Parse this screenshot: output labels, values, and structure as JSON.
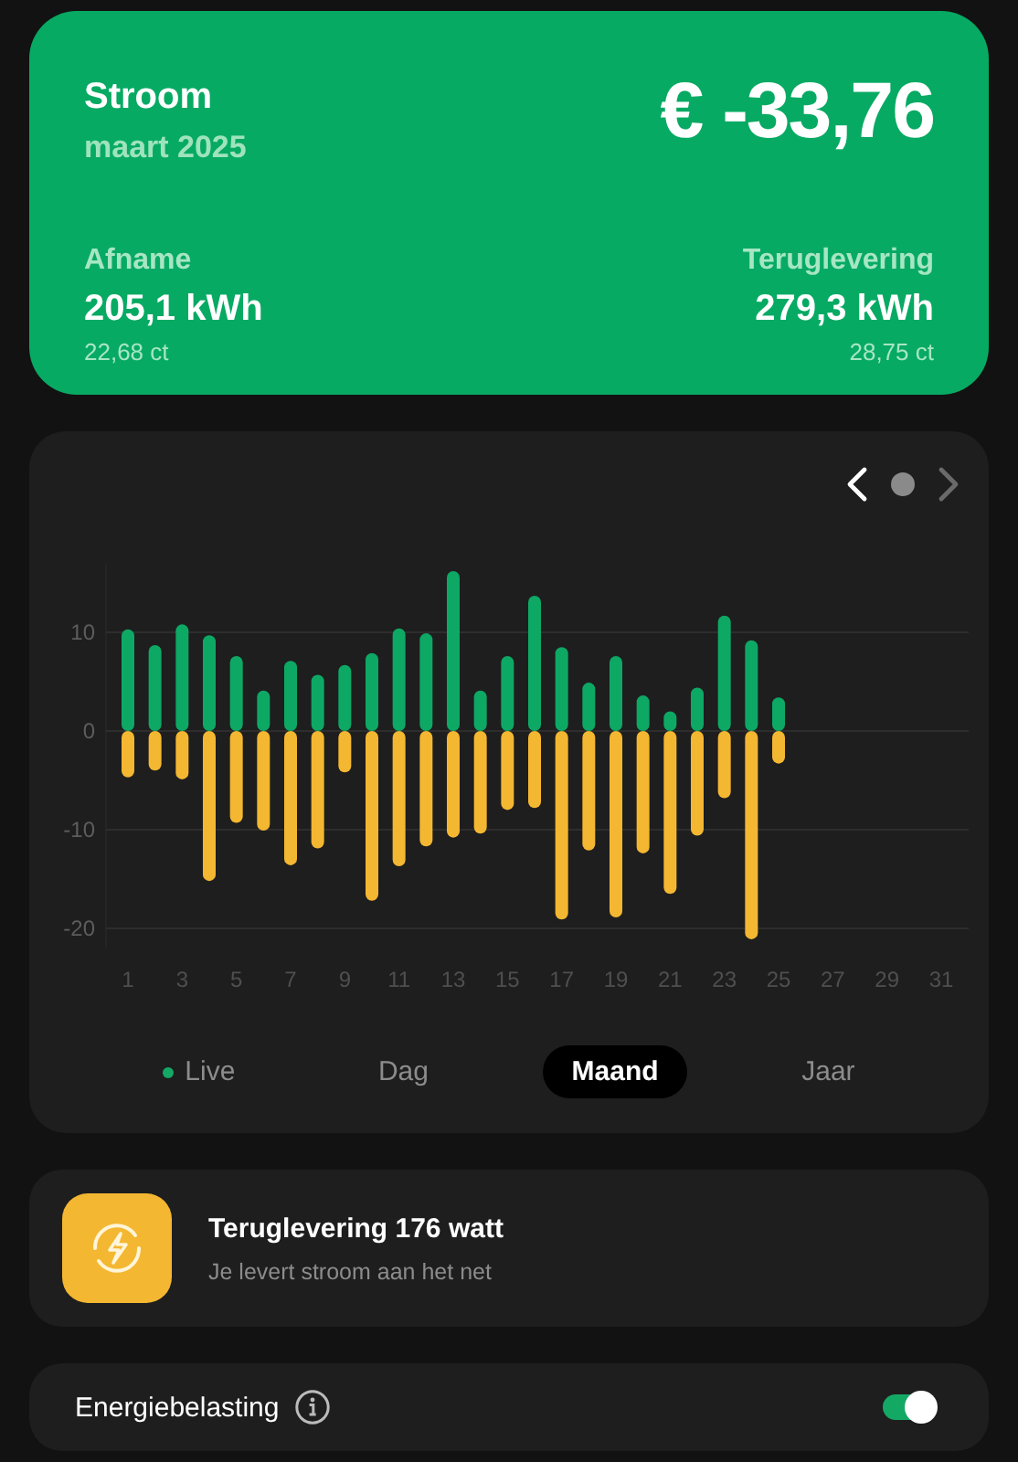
{
  "summary": {
    "title": "Stroom",
    "period": "maart 2025",
    "total": "€ -33,76",
    "stats": [
      {
        "label": "Afname",
        "value": "205,1 kWh",
        "price": "22,68 ct"
      },
      {
        "label": "Teruglevering",
        "value": "279,3 kWh",
        "price": "28,75 ct"
      }
    ]
  },
  "chart_card": {
    "pager": {
      "prev_disabled": false,
      "next_disabled": true
    },
    "chart_data": {
      "type": "bar",
      "stacked": true,
      "grid": true,
      "x": [
        1,
        2,
        3,
        4,
        5,
        6,
        7,
        8,
        9,
        10,
        11,
        12,
        13,
        14,
        15,
        16,
        17,
        18,
        19,
        20,
        21,
        22,
        23,
        24,
        25
      ],
      "series": [
        {
          "color": "#0ea865",
          "values": [
            10.3,
            8.7,
            10.8,
            9.7,
            7.6,
            4.1,
            7.1,
            5.7,
            6.7,
            7.9,
            10.4,
            9.9,
            16.2,
            4.1,
            7.6,
            13.7,
            8.5,
            4.9,
            7.6,
            3.6,
            2.0,
            4.4,
            11.7,
            9.2,
            3.4
          ]
        },
        {
          "color": "#f4b731",
          "values": [
            -4.7,
            -4.0,
            -4.9,
            -15.2,
            -9.3,
            -10.1,
            -13.6,
            -11.9,
            -4.2,
            -17.2,
            -13.7,
            -11.7,
            -10.8,
            -10.4,
            -8.0,
            -7.8,
            -19.1,
            -12.1,
            -18.9,
            -12.4,
            -16.5,
            -10.6,
            -6.8,
            -21.1,
            -3.3
          ]
        }
      ],
      "xlim": [
        1,
        31
      ],
      "ylim": [
        -22,
        17
      ],
      "yticks": [
        -20,
        -10,
        0,
        10
      ],
      "xticks": [
        1,
        3,
        5,
        7,
        9,
        11,
        13,
        15,
        17,
        19,
        21,
        23,
        25,
        27,
        29,
        31
      ]
    },
    "tabs": [
      {
        "label": "Live",
        "kind": "live",
        "selected": false
      },
      {
        "label": "Dag",
        "kind": "plain",
        "selected": false
      },
      {
        "label": "Maand",
        "kind": "plain",
        "selected": true
      },
      {
        "label": "Jaar",
        "kind": "plain",
        "selected": false
      }
    ]
  },
  "status": {
    "title": "Teruglevering 176 watt",
    "subtitle": "Je levert stroom aan het net"
  },
  "setting": {
    "label": "Energiebelasting",
    "on": true
  }
}
